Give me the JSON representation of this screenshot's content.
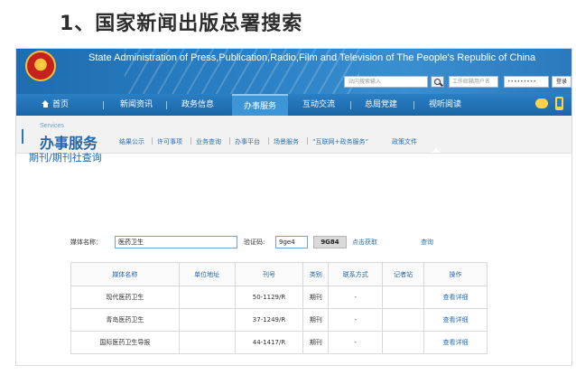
{
  "slide": {
    "title": "1、国家新闻出版总署搜索"
  },
  "banner": {
    "english_title": "State Administration of Press,Publication,Radio,Film and Television of The People's Republic of China",
    "search_placeholder": "站内搜索输入",
    "email_placeholder": "工作邮箱用户名",
    "password_mask": "•••••••••",
    "login_label": "登录",
    "brand_color": "#1d6db0"
  },
  "nav": {
    "items": [
      {
        "label": "首页",
        "icon": "home-icon"
      },
      {
        "label": "新闻资讯"
      },
      {
        "label": "政务信息"
      },
      {
        "label": "办事服务",
        "active": true
      },
      {
        "label": "互动交流"
      },
      {
        "label": "总局党建"
      },
      {
        "label": "视听阅读"
      }
    ],
    "right_icons": [
      "wechat-icon",
      "mobile-icon"
    ]
  },
  "services": {
    "english": "Services",
    "title": "办事服务",
    "links": [
      "结果公示",
      "许可事项",
      "业务查询",
      "办事平台",
      "场景服务",
      "“互联网+政务服务”",
      "政策文件"
    ]
  },
  "query": {
    "title": "期刊/期刊社查询",
    "media_label": "媒体名称：",
    "media_value": "医药卫生",
    "code_label": "验证码:",
    "code_value": "9ge4",
    "captcha_text": "9G84",
    "refresh_label": "点击获取",
    "query_label": "查询"
  },
  "table": {
    "headers": [
      "媒体名称",
      "单位地址",
      "刊号",
      "类别",
      "联系方式",
      "记者站",
      "操作"
    ],
    "rows": [
      [
        "现代医药卫生",
        "",
        "50-1129/R",
        "期刊",
        "-",
        "",
        "查看详细"
      ],
      [
        "青岛医药卫生",
        "",
        "37-1249/R",
        "期刊",
        "-",
        "",
        "查看详细"
      ],
      [
        "国际医药卫生导报",
        "",
        "44-1417/R",
        "期刊",
        "-",
        "",
        "查看详细"
      ]
    ]
  }
}
